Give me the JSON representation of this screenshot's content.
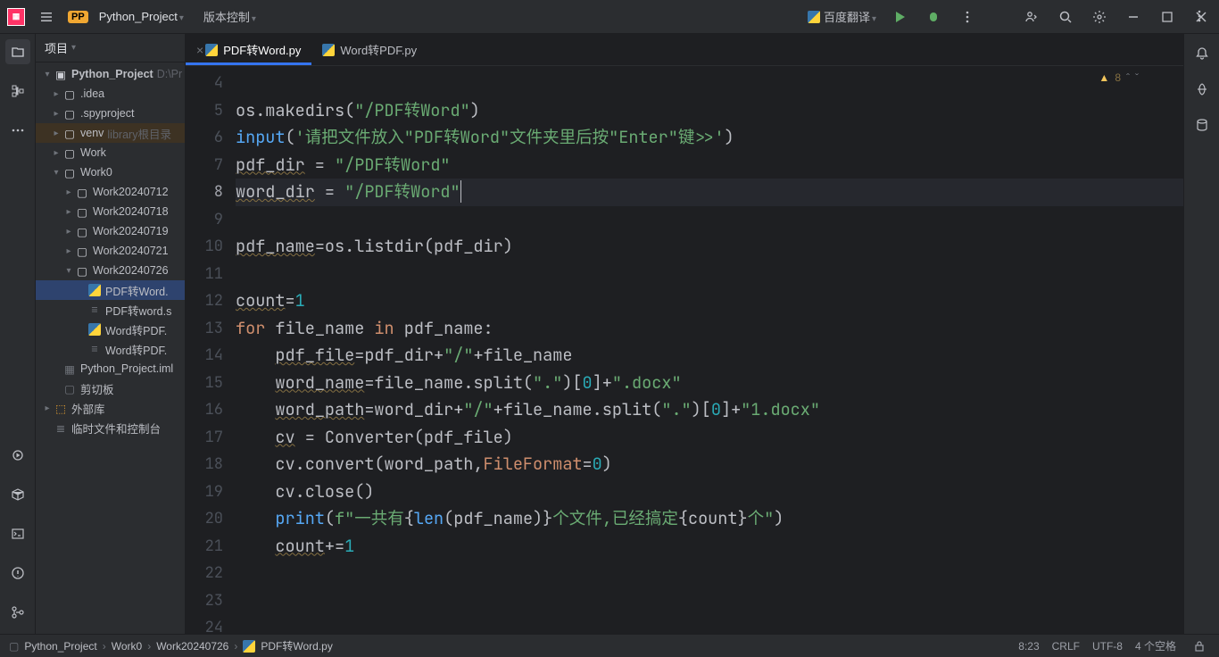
{
  "titlebar": {
    "project_badge": "PP",
    "project_name": "Python_Project",
    "vc_label": "版本控制",
    "run_config": "百度翻译"
  },
  "project_panel": {
    "header": "项目",
    "root": {
      "name": "Python_Project",
      "hint": "D:\\Pr"
    },
    "items": {
      "idea": ".idea",
      "spyproject": ".spyproject",
      "venv": "venv",
      "venv_hint": "library根目录",
      "work": "Work",
      "work0": "Work0",
      "w0712": "Work20240712",
      "w0718": "Work20240718",
      "w0719": "Work20240719",
      "w0721": "Work20240721",
      "w0726": "Work20240726",
      "file1": "PDF转Word.",
      "file2": "PDF转word.s",
      "file3": "Word转PDF.",
      "file4": "Word转PDF.",
      "iml": "Python_Project.iml",
      "clipboard": "剪切板",
      "extlib": "外部库",
      "scratch": "临时文件和控制台"
    }
  },
  "tabs": {
    "active": "PDF转Word.py",
    "other": "Word转PDF.py"
  },
  "gutter_start": 4,
  "gutter_end": 24,
  "hints": {
    "warn_count": "8"
  },
  "status": {
    "crumbs": [
      "Python_Project",
      "Work0",
      "Work20240726",
      "PDF转Word.py"
    ],
    "pos": "8:23",
    "eol": "CRLF",
    "enc": "UTF-8",
    "indent": "4 个空格"
  }
}
